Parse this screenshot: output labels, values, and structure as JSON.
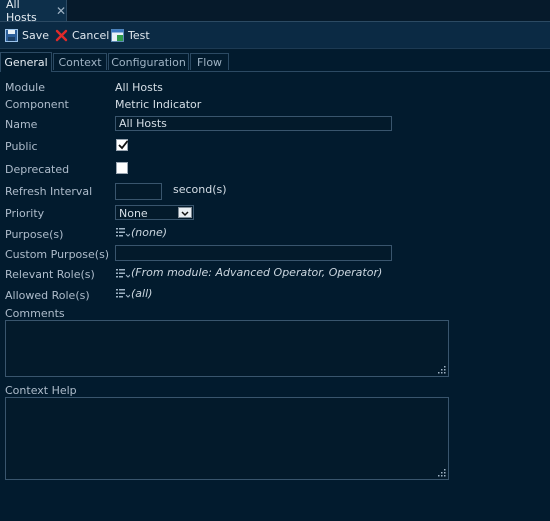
{
  "doc_tab": {
    "title": "All Hosts"
  },
  "toolbar": {
    "save": "Save",
    "cancel": "Cancel",
    "test": "Test"
  },
  "tabs": [
    "General",
    "Context",
    "Configuration",
    "Flow"
  ],
  "form": {
    "module": {
      "label": "Module",
      "value": "All Hosts"
    },
    "component": {
      "label": "Component",
      "value": "Metric Indicator"
    },
    "name": {
      "label": "Name",
      "value": "All Hosts"
    },
    "public": {
      "label": "Public",
      "checked": true
    },
    "deprecated": {
      "label": "Deprecated",
      "checked": false
    },
    "refresh": {
      "label": "Refresh Interval",
      "value": "",
      "unit": "second(s)"
    },
    "priority": {
      "label": "Priority",
      "value": "None"
    },
    "purposes": {
      "label": "Purpose(s)",
      "value": "(none)"
    },
    "custom_purpose": {
      "label": "Custom Purpose(s)",
      "value": ""
    },
    "relevant_roles": {
      "label": "Relevant Role(s)",
      "value": "(From module: Advanced Operator, Operator)"
    },
    "allowed_roles": {
      "label": "Allowed Role(s)",
      "value": "(all)"
    },
    "comments": {
      "label": "Comments",
      "value": ""
    },
    "context_help": {
      "label": "Context Help",
      "value": ""
    }
  },
  "colors": {
    "background": "#021b2e",
    "toolbar": "#0b2a44",
    "border": "#39556d"
  },
  "icons": {
    "save": "floppy-disk-icon",
    "cancel": "red-x-icon",
    "test": "test-window-icon",
    "close": "close-icon",
    "list": "list-icon",
    "check": "checkmark-icon",
    "dropdown": "chevron-down-icon",
    "grip": "resize-grip-icon"
  }
}
